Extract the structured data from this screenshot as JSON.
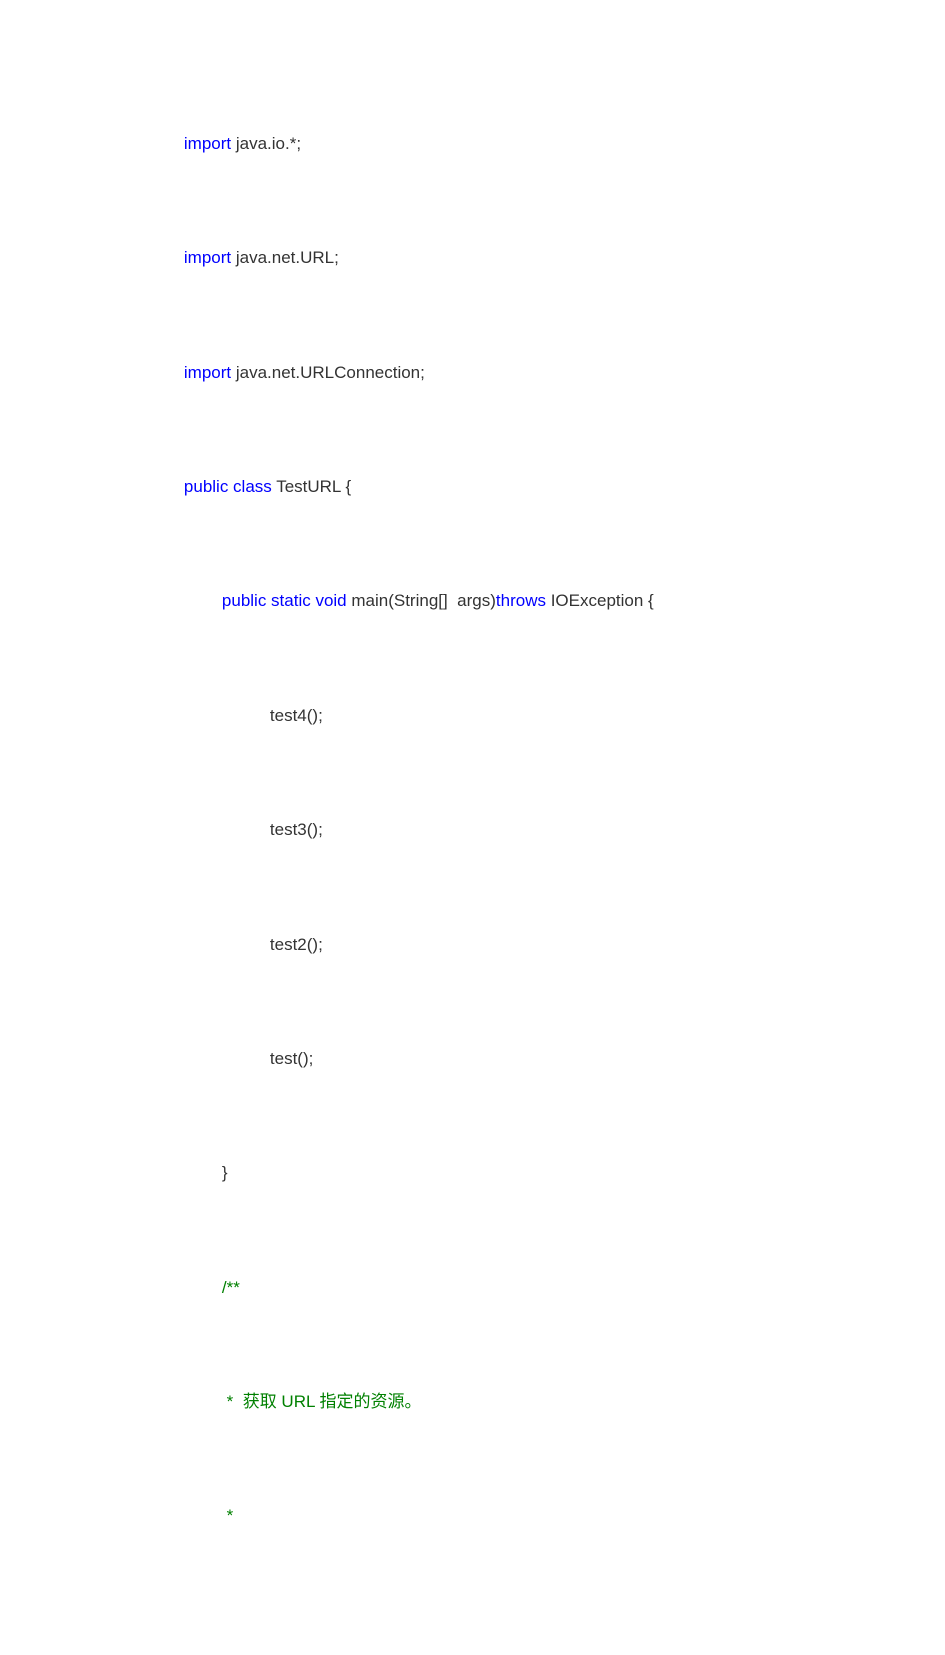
{
  "code": {
    "l1": {
      "kw": "import",
      "rest": " java.io.*;"
    },
    "l2": {
      "kw": "import",
      "rest": " java.net.URL;"
    },
    "l3": {
      "kw": "import",
      "rest": " java.net.URLConnection;"
    },
    "l4": {
      "kw": "public class",
      "rest": " TestURL {"
    },
    "l5": {
      "kw1": "public static void",
      "mid": " main(String[]  args)",
      "kw2": "throws",
      "rest": " IOException {"
    },
    "l6": "test4();",
    "l7": "test3();",
    "l8": "test2();",
    "l9": "test();",
    "l10": "}",
    "l11": "/**",
    "l12": " *  获取 URL 指定的资源。",
    "l13": " *"
  }
}
